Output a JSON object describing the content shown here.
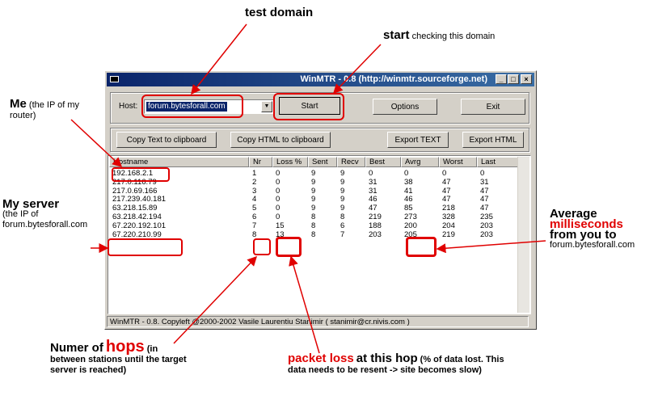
{
  "window": {
    "title": "WinMTR - 0.8 (http://winmtr.sourceforge.net)",
    "icon": "winmtr-app-icon",
    "controls": [
      "minimize",
      "maximize",
      "close"
    ],
    "host_label": "Host:",
    "host_value": "forum.bytesforall.com",
    "start_label": "Start",
    "options_label": "Options",
    "exit_label": "Exit",
    "copy_text_label": "Copy Text to clipboard",
    "copy_html_label": "Copy HTML to clipboard",
    "export_text_label": "Export TEXT",
    "export_html_label": "Export HTML",
    "columns": [
      "Hostname",
      "Nr",
      "Loss %",
      "Sent",
      "Recv",
      "Best",
      "Avrg",
      "Worst",
      "Last"
    ],
    "rows": [
      [
        "192.168.2.1",
        "1",
        "0",
        "9",
        "9",
        "0",
        "0",
        "0",
        "0"
      ],
      [
        "217.0.116.79",
        "2",
        "0",
        "9",
        "9",
        "31",
        "38",
        "47",
        "31"
      ],
      [
        "217.0.69.166",
        "3",
        "0",
        "9",
        "9",
        "31",
        "41",
        "47",
        "47"
      ],
      [
        "217.239.40.181",
        "4",
        "0",
        "9",
        "9",
        "46",
        "46",
        "47",
        "47"
      ],
      [
        "63.218.15.89",
        "5",
        "0",
        "9",
        "9",
        "47",
        "85",
        "218",
        "47"
      ],
      [
        "63.218.42.194",
        "6",
        "0",
        "8",
        "8",
        "219",
        "273",
        "328",
        "235"
      ],
      [
        "67.220.192.101",
        "7",
        "15",
        "8",
        "6",
        "188",
        "200",
        "204",
        "203"
      ],
      [
        "67.220.210.99",
        "8",
        "13",
        "8",
        "7",
        "203",
        "205",
        "219",
        "203"
      ]
    ],
    "status": "WinMTR - 0.8. Copyleft @2000-2002 Vasile Laurentiu Stanimir  ( stanimir@cr.nivis.com )"
  },
  "annotations": {
    "test_domain": "test domain",
    "start_big": "start",
    "start_rest": "checking this domain",
    "me_big": "Me",
    "me_rest": "(the IP of my router)",
    "my_server_big": "My server",
    "my_server_rest": "(the IP of forum.bytesforall.com",
    "average_1": "Average",
    "average_2": "milliseconds",
    "average_3": "from you to",
    "average_4": "forum.bytesforall.com",
    "hops_pre": "Numer of",
    "hops_big": "hops",
    "hops_rest": "(in between stations until the target server is reached)",
    "loss_big": "packet loss",
    "loss_mid": "at this hop",
    "loss_rest": "(% of data lost. This data needs to be resent -> site becomes slow)"
  },
  "colors": {
    "highlight": "#e00000",
    "titlebar": "#0a246a",
    "window": "#d4d0c8"
  }
}
